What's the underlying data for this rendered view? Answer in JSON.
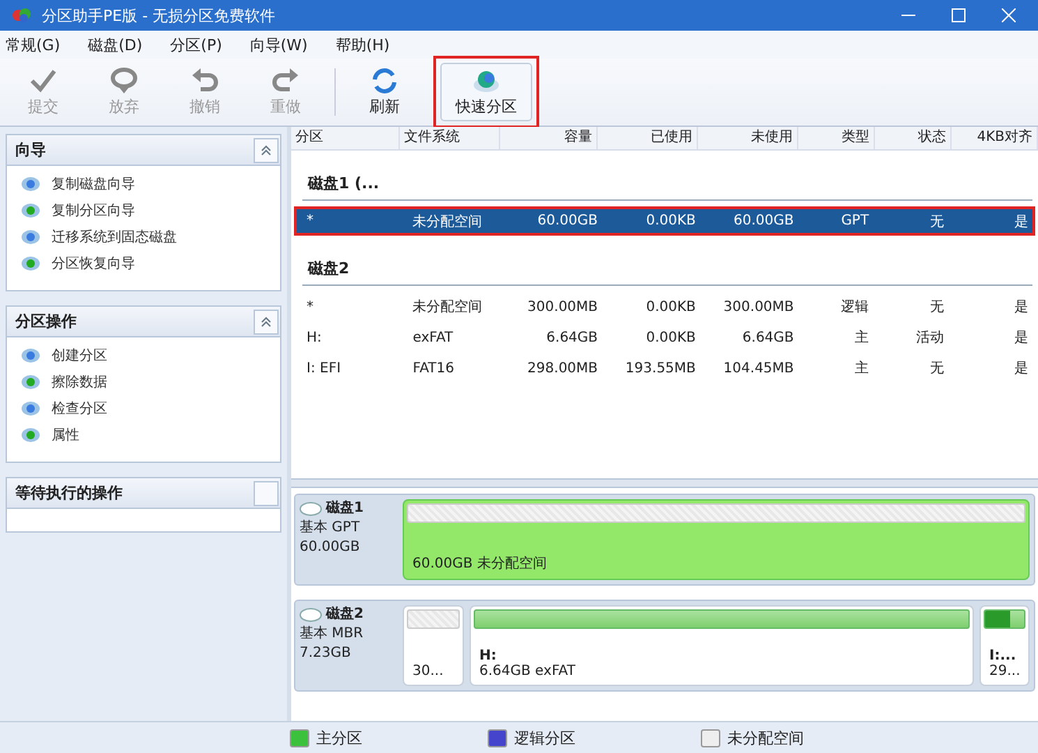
{
  "window": {
    "title": "分区助手PE版 - 无损分区免费软件"
  },
  "menu": [
    "常规(G)",
    "磁盘(D)",
    "分区(P)",
    "向导(W)",
    "帮助(H)"
  ],
  "toolbar": [
    {
      "kind": "check",
      "label": "提交",
      "disabled": true,
      "highlighted": false
    },
    {
      "kind": "discard",
      "label": "放弃",
      "disabled": true,
      "highlighted": false
    },
    {
      "kind": "undo",
      "label": "撤销",
      "disabled": true,
      "highlighted": false
    },
    {
      "kind": "redo",
      "label": "重做",
      "disabled": true,
      "highlighted": false
    },
    {
      "kind": "refresh",
      "label": "刷新",
      "disabled": false,
      "highlighted": false
    },
    {
      "kind": "quick",
      "label": "快速分区",
      "disabled": false,
      "highlighted": true
    }
  ],
  "sidebar": [
    {
      "title": "向导",
      "expanded": true,
      "items": [
        "复制磁盘向导",
        "复制分区向导",
        "迁移系统到固态磁盘",
        "分区恢复向导"
      ]
    },
    {
      "title": "分区操作",
      "expanded": true,
      "items": [
        "创建分区",
        "擦除数据",
        "检查分区",
        "属性"
      ]
    },
    {
      "title": "等待执行的操作",
      "expanded": false
    }
  ],
  "table": {
    "columns": [
      "分区",
      "文件系统",
      "容量",
      "已使用",
      "未使用",
      "类型",
      "状态",
      "4KB对齐"
    ],
    "disks": [
      {
        "name": "磁盘1 (...",
        "rows": [
          {
            "cells": [
              "*",
              "未分配空间",
              "60.00GB",
              "0.00KB",
              "60.00GB",
              "GPT",
              "无",
              "是"
            ],
            "selected": true,
            "highlighted": true
          }
        ]
      },
      {
        "name": "磁盘2",
        "rows": [
          {
            "cells": [
              "*",
              "未分配空间",
              "300.00MB",
              "0.00KB",
              "300.00MB",
              "逻辑",
              "无",
              "是"
            ],
            "selected": false,
            "highlighted": false
          },
          {
            "cells": [
              "H:",
              "exFAT",
              "6.64GB",
              "0.00KB",
              "6.64GB",
              "主",
              "活动",
              "是"
            ],
            "selected": false,
            "highlighted": false
          },
          {
            "cells": [
              "I: EFI",
              "FAT16",
              "298.00MB",
              "193.55MB",
              "104.45MB",
              "主",
              "无",
              "是"
            ],
            "selected": false,
            "highlighted": false
          }
        ]
      }
    ]
  },
  "disk_map": [
    {
      "name": "磁盘1",
      "scheme": "基本 GPT",
      "size": "60.00GB",
      "partitions": [
        {
          "kind": "unallocated",
          "selected": true,
          "detail": "60.00GB 未分配空间"
        }
      ]
    },
    {
      "name": "磁盘2",
      "scheme": "基本 MBR",
      "size": "7.23GB",
      "partitions": [
        {
          "kind": "unallocated",
          "selected": false,
          "detail": "30..."
        },
        {
          "kind": "primary",
          "selected": false,
          "name": "H:",
          "detail": "6.64GB exFAT"
        },
        {
          "kind": "primary",
          "selected": false,
          "name": "I:...",
          "detail": "29...",
          "level": 0.65
        }
      ]
    }
  ],
  "legend": [
    {
      "kind": "primary",
      "label": "主分区"
    },
    {
      "kind": "logical",
      "label": "逻辑分区"
    },
    {
      "kind": "unallocated",
      "label": "未分配空间"
    }
  ]
}
